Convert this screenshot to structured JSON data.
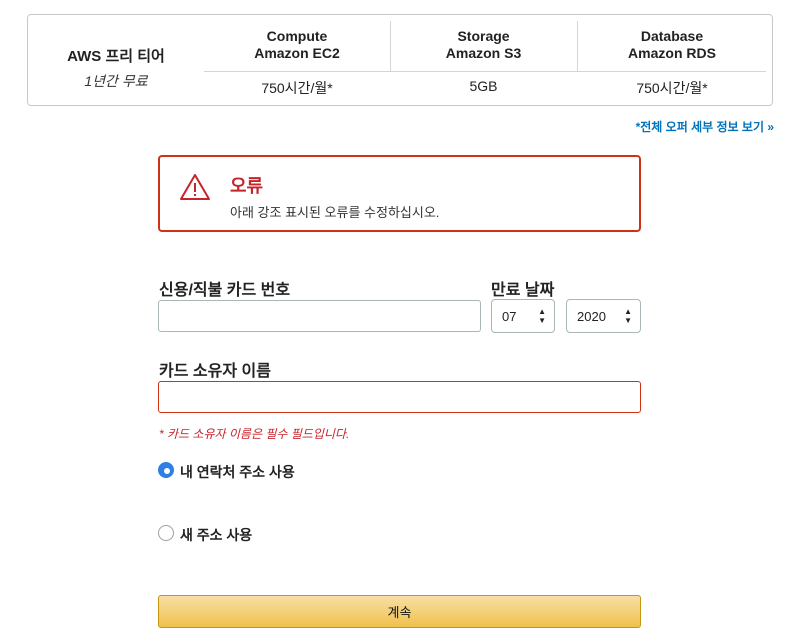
{
  "free_tier": {
    "title": "AWS 프리 티어",
    "subtitle": "1년간 무료",
    "columns": [
      {
        "line1": "Compute",
        "line2": "Amazon EC2",
        "value": "750시간/월*"
      },
      {
        "line1": "Storage",
        "line2": "Amazon S3",
        "value": "5GB"
      },
      {
        "line1": "Database",
        "line2": "Amazon RDS",
        "value": "750시간/월*"
      }
    ],
    "offer_link": "*전체 오퍼 세부 정보 보기 »"
  },
  "alert": {
    "icon": "warning-icon",
    "title": "오류",
    "message": "아래 강조 표시된 오류를 수정하십시오.",
    "color": "#d13212"
  },
  "form": {
    "card_number_label": "신용/직불 카드 번호",
    "card_number_value": "",
    "expiry_label": "만료 날짜",
    "expiry_month": "07",
    "expiry_year": "2020",
    "cardholder_label": "카드 소유자 이름",
    "cardholder_value": "",
    "cardholder_error": "* 카드 소유자 이름은 필수 필드입니다.",
    "address_options": [
      {
        "label": "내 연락처 주소 사용",
        "selected": true
      },
      {
        "label": "새 주소 사용",
        "selected": false
      }
    ],
    "continue_label": "계속"
  }
}
